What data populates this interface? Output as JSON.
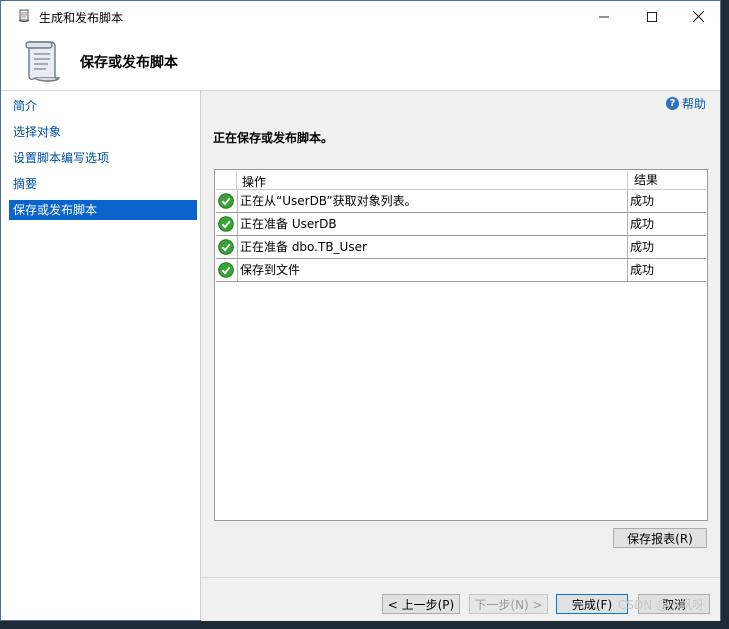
{
  "window": {
    "title": "生成和发布脚本"
  },
  "header": {
    "title": "保存或发布脚本"
  },
  "sidebar": {
    "items": [
      {
        "label": "简介",
        "active": false
      },
      {
        "label": "选择对象",
        "active": false
      },
      {
        "label": "设置脚本编写选项",
        "active": false
      },
      {
        "label": "摘要",
        "active": false
      },
      {
        "label": "保存或发布脚本",
        "active": true
      }
    ]
  },
  "content": {
    "help_label": "帮助",
    "section_title": "正在保存或发布脚本。",
    "grid": {
      "columns": {
        "operation": "操作",
        "result": "结果"
      },
      "rows": [
        {
          "operation": "正在从“UserDB”获取对象列表。",
          "result": "成功",
          "status": "success-icon"
        },
        {
          "operation": "正在准备 UserDB",
          "result": "成功",
          "status": "success-icon"
        },
        {
          "operation": "正在准备 dbo.TB_User",
          "result": "成功",
          "status": "success-icon"
        },
        {
          "operation": "保存到文件",
          "result": "成功",
          "status": "success-icon"
        }
      ]
    },
    "save_report_label": "保存报表(R)"
  },
  "footer": {
    "prev_label": "< 上一步(P)",
    "next_label": "下一步(N) >",
    "finish_label": "完成(F)",
    "cancel_label": "取消"
  },
  "watermark": "CSDN @小帆呀",
  "colors": {
    "accent": "#0a64cc",
    "link": "#0050a8",
    "success": "#3aa33a"
  }
}
